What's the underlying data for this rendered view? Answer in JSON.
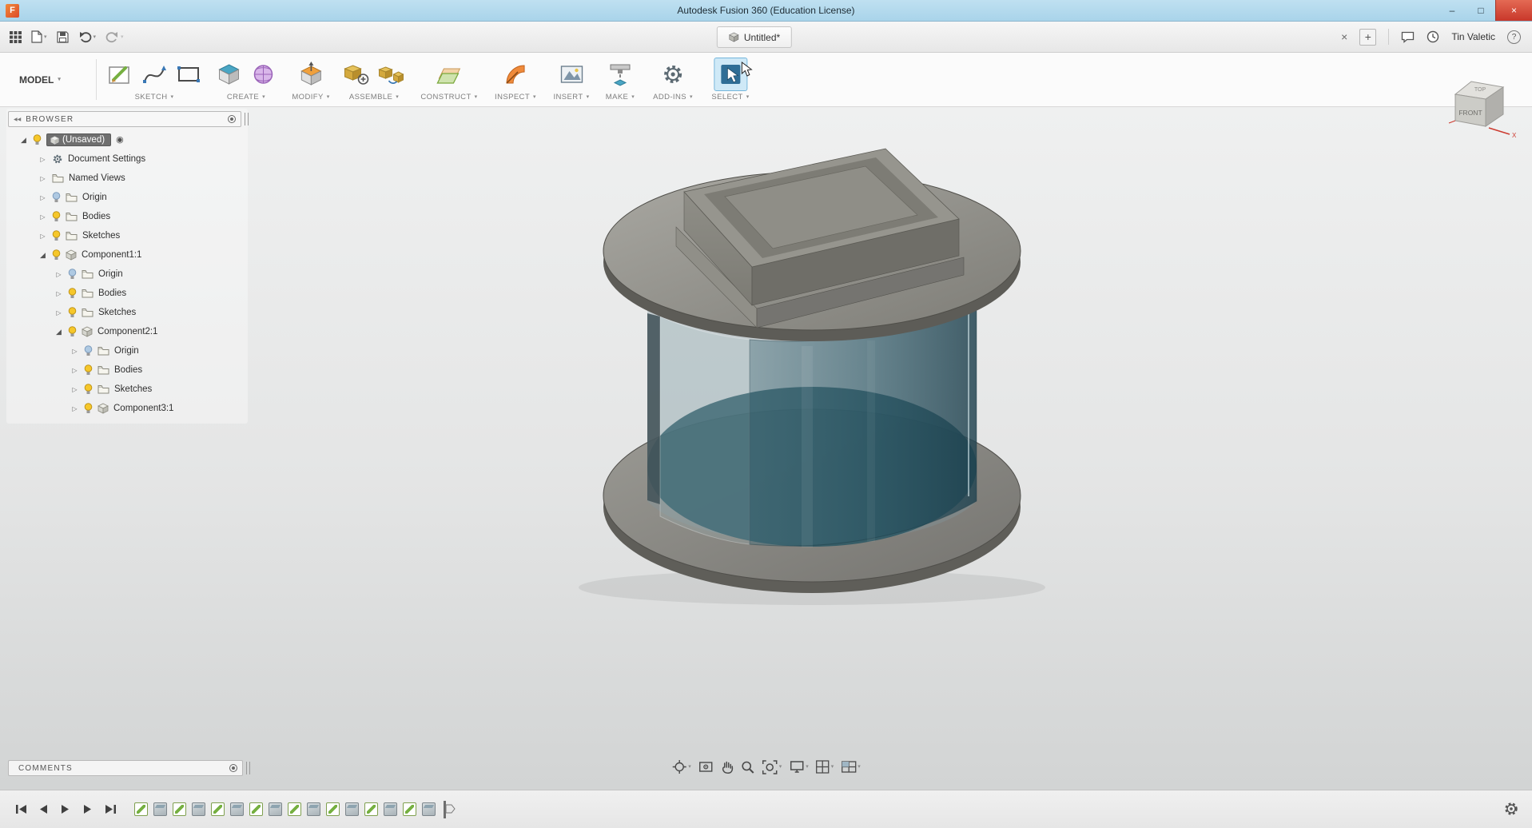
{
  "icons": {
    "caret": "▾",
    "tri_collapsed": "▷",
    "tri_expanded": "◢",
    "collapse_left": "◀◀",
    "radio": "◉",
    "help": "?",
    "close_tab": "×",
    "add_tab": "+",
    "minimize": "–",
    "maximize": "□",
    "close": "×"
  },
  "window": {
    "logo": "F",
    "title": "Autodesk Fusion 360 (Education License)"
  },
  "appbar": {
    "tab_label": "Untitled*",
    "user": "Tin Valetic"
  },
  "toolbar": {
    "workspace": "MODEL",
    "groups": [
      {
        "label": "SKETCH"
      },
      {
        "label": "CREATE"
      },
      {
        "label": "MODIFY"
      },
      {
        "label": "ASSEMBLE"
      },
      {
        "label": "CONSTRUCT"
      },
      {
        "label": "INSPECT"
      },
      {
        "label": "INSERT"
      },
      {
        "label": "MAKE"
      },
      {
        "label": "ADD-INS"
      },
      {
        "label": "SELECT"
      }
    ]
  },
  "viewcube": {
    "front": "FRONT",
    "top": "TOP",
    "axis_x": "X"
  },
  "browser": {
    "title": "BROWSER",
    "items": [
      {
        "label": "(Unsaved)",
        "level": 0,
        "icon": "component",
        "expanded": true,
        "selected": true,
        "visibility": "on"
      },
      {
        "label": "Document Settings",
        "level": 1,
        "icon": "gear"
      },
      {
        "label": "Named Views",
        "level": 1,
        "icon": "folder"
      },
      {
        "label": "Origin",
        "level": 1,
        "icon": "folder",
        "visibility": "off"
      },
      {
        "label": "Bodies",
        "level": 1,
        "icon": "folder",
        "visibility": "on"
      },
      {
        "label": "Sketches",
        "level": 1,
        "icon": "folder",
        "visibility": "on"
      },
      {
        "label": "Component1:1",
        "level": 1,
        "icon": "component",
        "expanded": true,
        "visibility": "on"
      },
      {
        "label": "Origin",
        "level": 2,
        "icon": "folder",
        "visibility": "off"
      },
      {
        "label": "Bodies",
        "level": 2,
        "icon": "folder",
        "visibility": "on"
      },
      {
        "label": "Sketches",
        "level": 2,
        "icon": "folder",
        "visibility": "on"
      },
      {
        "label": "Component2:1",
        "level": 2,
        "icon": "component",
        "expanded": true,
        "visibility": "on"
      },
      {
        "label": "Origin",
        "level": 3,
        "icon": "folder",
        "visibility": "off"
      },
      {
        "label": "Bodies",
        "level": 3,
        "icon": "folder",
        "visibility": "on"
      },
      {
        "label": "Sketches",
        "level": 3,
        "icon": "folder",
        "visibility": "on"
      },
      {
        "label": "Component3:1",
        "level": 3,
        "icon": "component",
        "visibility": "on"
      }
    ]
  },
  "comments": {
    "title": "COMMENTS"
  },
  "timeline": {
    "features": [
      {
        "type": "sketch"
      },
      {
        "type": "extrude"
      },
      {
        "type": "sketch"
      },
      {
        "type": "extrude"
      },
      {
        "type": "sketch"
      },
      {
        "type": "extrude"
      },
      {
        "type": "sketch"
      },
      {
        "type": "extrude"
      },
      {
        "type": "sketch"
      },
      {
        "type": "extrude"
      },
      {
        "type": "sketch"
      },
      {
        "type": "extrude"
      },
      {
        "type": "sketch"
      },
      {
        "type": "extrude"
      },
      {
        "type": "sketch"
      },
      {
        "type": "extrude"
      }
    ]
  }
}
